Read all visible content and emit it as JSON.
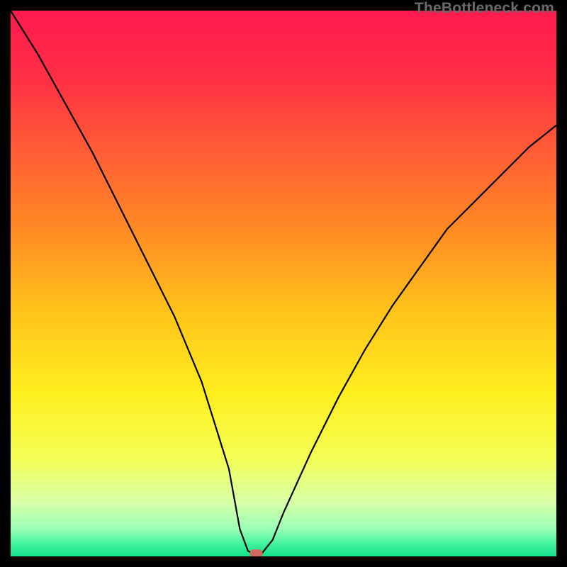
{
  "watermark": "TheBottleneck.com",
  "chart_data": {
    "type": "line",
    "title": "",
    "xlabel": "",
    "ylabel": "",
    "xlim": [
      0,
      100
    ],
    "ylim": [
      0,
      100
    ],
    "grid": false,
    "background": "rainbow-vertical",
    "series": [
      {
        "name": "bottleneck-curve",
        "color": "#000000",
        "x": [
          0,
          5,
          10,
          15,
          20,
          25,
          30,
          35,
          40,
          42,
          43.5,
          44.5,
          46,
          48,
          50,
          55,
          60,
          65,
          70,
          75,
          80,
          85,
          90,
          95,
          100
        ],
        "y": [
          100,
          92,
          83,
          74,
          64,
          54,
          44,
          32,
          16,
          5,
          1,
          0.5,
          0.5,
          3,
          8,
          19,
          29,
          38,
          46,
          53,
          60,
          65,
          70,
          75,
          79
        ]
      }
    ],
    "marker": {
      "x": 45,
      "y": 0.5,
      "color": "#cf6a5e",
      "shape": "rounded-rect"
    },
    "gradient_stops": [
      {
        "offset": 0.0,
        "color": "#ff1a4f"
      },
      {
        "offset": 0.12,
        "color": "#ff2e45"
      },
      {
        "offset": 0.25,
        "color": "#ff5a36"
      },
      {
        "offset": 0.4,
        "color": "#ff8a24"
      },
      {
        "offset": 0.55,
        "color": "#ffc21a"
      },
      {
        "offset": 0.7,
        "color": "#ffee1e"
      },
      {
        "offset": 0.82,
        "color": "#f4ff54"
      },
      {
        "offset": 0.9,
        "color": "#d8ffa6"
      },
      {
        "offset": 0.95,
        "color": "#9bffb8"
      },
      {
        "offset": 0.98,
        "color": "#38f19a"
      },
      {
        "offset": 1.0,
        "color": "#17e28a"
      }
    ]
  }
}
